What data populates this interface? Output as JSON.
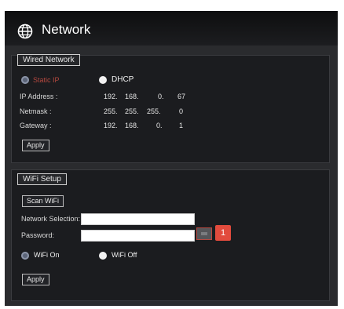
{
  "window": {
    "title": "Network",
    "icon": "globe-icon"
  },
  "wired": {
    "legend": "Wired Network",
    "static_ip_label": "Static IP",
    "dhcp_label": "DHCP",
    "ip_label": "IP Address :",
    "netmask_label": "Netmask :",
    "gateway_label": "Gateway :",
    "ip": [
      "192.",
      "168.",
      "0.",
      "67"
    ],
    "netmask": [
      "255.",
      "255.",
      "255.",
      "0"
    ],
    "gateway": [
      "192.",
      "168.",
      "0.",
      "1"
    ],
    "apply_label": "Apply"
  },
  "wifi": {
    "legend": "WiFi Setup",
    "scan_label": "Scan WiFi",
    "network_selection_label": "Network Selection:",
    "password_label": "Password:",
    "on_label": "WiFi On",
    "off_label": "WiFi Off",
    "apply_label": "Apply",
    "badge": "1"
  },
  "colors": {
    "accent_red": "#e24b3d",
    "panel": "#2a2b2e",
    "section": "#1b1c1f"
  }
}
